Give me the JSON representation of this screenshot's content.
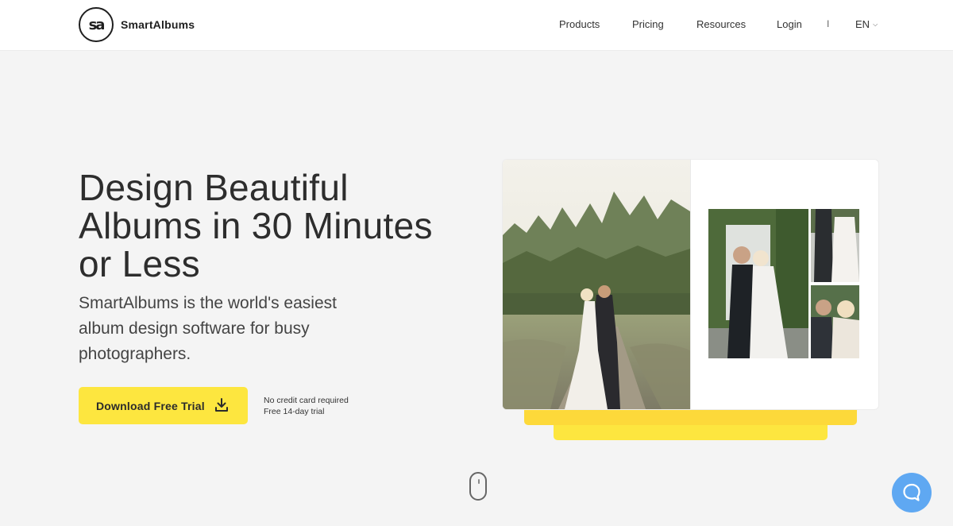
{
  "header": {
    "logo_mark": "sa",
    "brand": "SmartAlbums",
    "nav": [
      {
        "label": "Products"
      },
      {
        "label": "Pricing"
      },
      {
        "label": "Resources"
      },
      {
        "label": "Login"
      }
    ],
    "separator": "I",
    "language": "EN"
  },
  "hero": {
    "title": "Design Beautiful Albums in 30 Minutes or Less",
    "subtitle": "SmartAlbums is the world's easiest album design software for busy photographers.",
    "cta_label": "Download Free Trial",
    "note_1": "No credit card required",
    "note_2": "Free 14-day trial"
  },
  "icons": {
    "cta": "download-icon",
    "chat": "chat-bubble-icon",
    "scroll": "mouse-scroll-icon",
    "lang": "chevron-down-icon"
  },
  "colors": {
    "accent_yellow": "#fde63f",
    "chat_blue": "#5fa8f2",
    "background": "#f4f4f4"
  }
}
